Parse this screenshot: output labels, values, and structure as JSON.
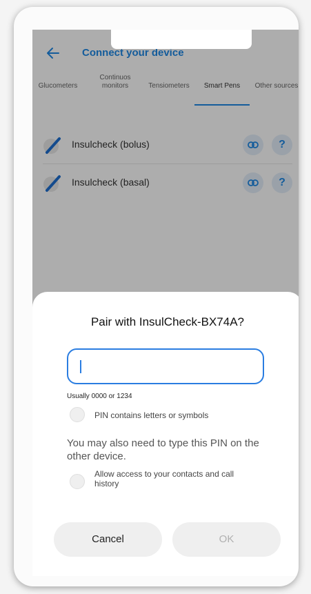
{
  "header": {
    "title": "Connect your device"
  },
  "tabs": [
    {
      "label": "Glucometers"
    },
    {
      "label": "Continuos monitors"
    },
    {
      "label": "Tensiometers"
    },
    {
      "label": "Smart Pens",
      "active": true
    },
    {
      "label": "Other sources"
    }
  ],
  "devices": [
    {
      "name": "Insulcheck (bolus)",
      "icon": "pen-icon"
    },
    {
      "name": "Insulcheck (basal)",
      "icon": "pen-icon"
    }
  ],
  "help_symbol": "?",
  "dialog": {
    "title": "Pair with InsulCheck-BX74A?",
    "pin_value": "",
    "hint": "Usually 0000 or 1234",
    "option_pin_letters": "PIN contains letters or symbols",
    "note": "You may also need to type this PIN on the other device.",
    "option_contacts": "Allow access to your contacts and call history",
    "cancel_label": "Cancel",
    "ok_label": "OK"
  },
  "colors": {
    "accent": "#1e88e5",
    "input_border": "#2a7de1"
  }
}
